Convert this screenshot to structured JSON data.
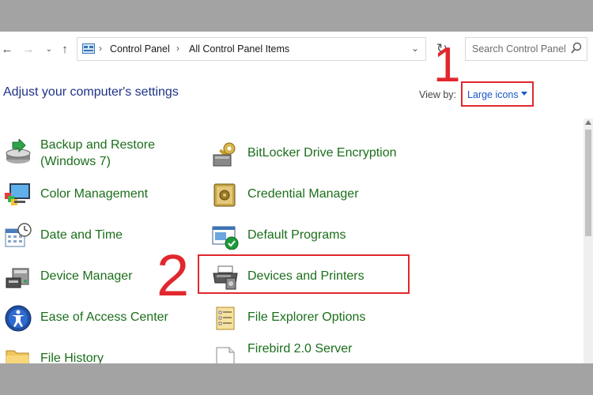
{
  "address_bar": {
    "crumbs": [
      "Control Panel",
      "All Control Panel Items"
    ]
  },
  "search": {
    "placeholder": "Search Control Panel"
  },
  "header": {
    "title": "Adjust your computer's settings",
    "view_by_label": "View by:",
    "view_by_value": "Large icons"
  },
  "annotations": {
    "step1": "1",
    "step2": "2"
  },
  "items_left": [
    {
      "label": "Backup and Restore",
      "label2": "(Windows 7)",
      "icon": "backup-icon"
    },
    {
      "label": "Color Management",
      "icon": "color-management-icon"
    },
    {
      "label": "Date and Time",
      "icon": "calendar-clock-icon"
    },
    {
      "label": "Device Manager",
      "icon": "device-manager-icon"
    },
    {
      "label": "Ease of Access Center",
      "icon": "ease-of-access-icon"
    },
    {
      "label": "File History",
      "icon": "file-history-icon"
    }
  ],
  "items_right": [
    {
      "label": "BitLocker Drive Encryption",
      "icon": "bitlocker-keys-icon"
    },
    {
      "label": "Credential Manager",
      "icon": "credential-safe-icon"
    },
    {
      "label": "Default Programs",
      "icon": "default-programs-icon"
    },
    {
      "label": "Devices and Printers",
      "icon": "printer-icon"
    },
    {
      "label": "File Explorer Options",
      "icon": "folder-options-icon"
    },
    {
      "label": "Firebird 2.0 Server",
      "icon": "document-icon"
    }
  ],
  "colors": {
    "link_green": "#1b6e1b",
    "heading_blue": "#1e3287",
    "annotation_red": "#e0282e",
    "select_blue": "#1a56c9"
  }
}
